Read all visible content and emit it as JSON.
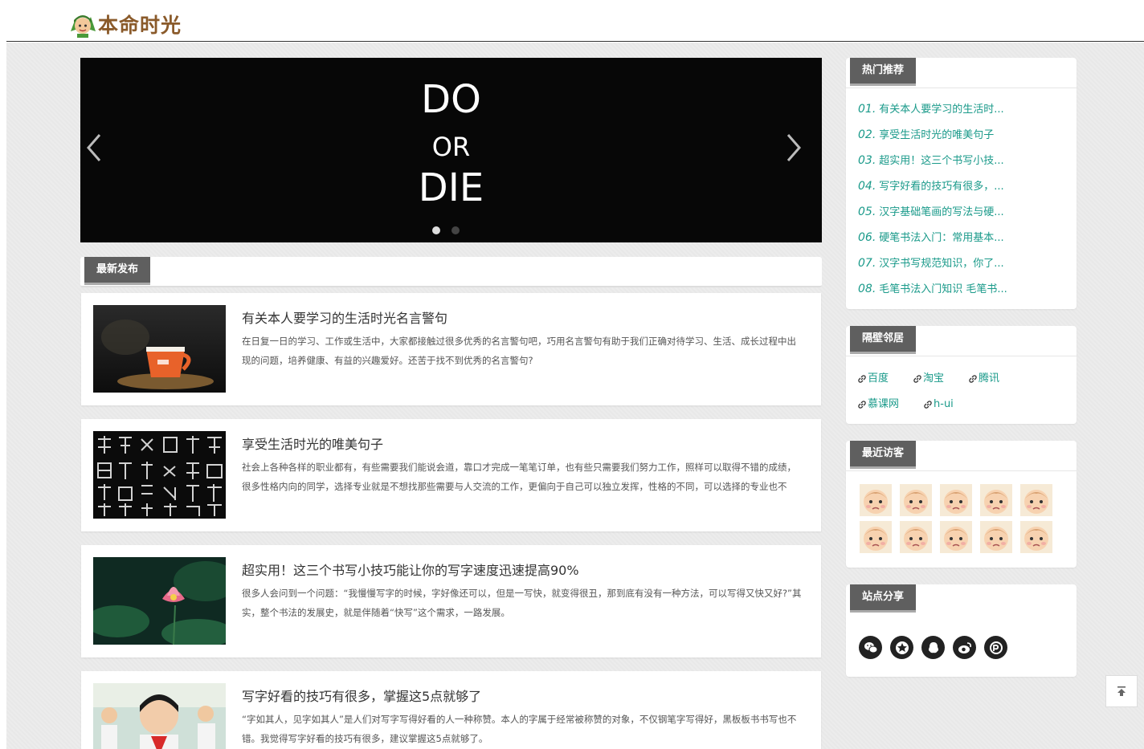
{
  "header": {
    "site_title": "本命时光"
  },
  "banner": {
    "line1": "DO",
    "line2": "OR",
    "line3": "DIE"
  },
  "latest": {
    "title": "最新发布"
  },
  "articles": [
    {
      "title": "有关本人要学习的生活时光名言警句",
      "desc": "在日复一日的学习、工作或生活中，大家都接触过很多优秀的名言警句吧，巧用名言警句有助于我们正确对待学习、生活、成长过程中出现的问题，培养健康、有益的兴趣爱好。还苦于找不到优秀的名言警句?"
    },
    {
      "title": "享受生活时光的唯美句子",
      "desc": "社会上各种各样的职业都有，有些需要我们能说会道，靠口才完成一笔笔订单，也有些只需要我们努力工作，照样可以取得不错的成绩，很多性格内向的同学，选择专业就是不想找那些需要与人交流的工作，更偏向于自己可以独立发挥，性格的不同，可以选择的专业也不同。"
    },
    {
      "title": "超实用！这三个书写小技巧能让你的写字速度迅速提高90%",
      "desc": "很多人会问到一个问题：“我慢慢写字的时候，字好像还可以，但是一写快，就变得很丑，那到底有没有一种方法，可以写得又快又好?”其实，整个书法的发展史，就是伴随着“快写”这个需求，一路发展。"
    },
    {
      "title": "写字好看的技巧有很多，掌握这5点就够了",
      "desc": "“字如其人，见字如其人”是人们对写字写得好看的人一种称赞。本人的字属于经常被称赞的对象，不仅钢笔字写得好，黑板板书书写也不错。我觉得写字好看的技巧有很多，建议掌握这5点就够了。"
    }
  ],
  "sidebar": {
    "hot": {
      "title": "热门推荐",
      "items": [
        {
          "num": "01.",
          "text": "有关本人要学习的生活时..."
        },
        {
          "num": "02.",
          "text": "享受生活时光的唯美句子"
        },
        {
          "num": "03.",
          "text": "超实用！这三个书写小技..."
        },
        {
          "num": "04.",
          "text": "写字好看的技巧有很多，..."
        },
        {
          "num": "05.",
          "text": "汉字基础笔画的写法与硬..."
        },
        {
          "num": "06.",
          "text": "硬笔书法入门：常用基本..."
        },
        {
          "num": "07.",
          "text": "汉字书写规范知识，你了..."
        },
        {
          "num": "08.",
          "text": "毛笔书法入门知识 毛笔书..."
        }
      ]
    },
    "neighbors": {
      "title": "隔壁邻居",
      "links": [
        "百度",
        "淘宝",
        "腾讯",
        "慕课网",
        "h-ui"
      ]
    },
    "visitors": {
      "title": "最近访客",
      "count": 10
    },
    "share": {
      "title": "站点分享",
      "icons": [
        "wechat-icon",
        "qzone-icon",
        "qq-icon",
        "weibo-icon",
        "pengyou-icon"
      ]
    }
  },
  "colors": {
    "accent": "#1a9a8a",
    "tag_bg": "#5f5f5f"
  }
}
